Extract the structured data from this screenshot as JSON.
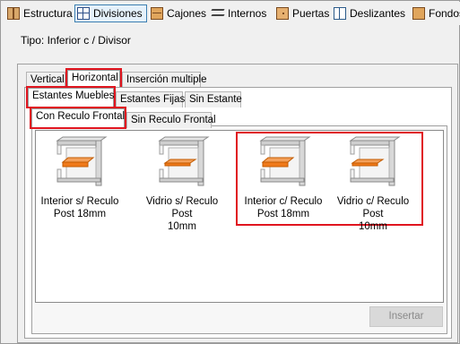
{
  "toolbar": {
    "items": [
      {
        "label": "Estructura",
        "icon": "structure-icon"
      },
      {
        "label": "Divisiones",
        "icon": "divisions-icon",
        "selected": true
      },
      {
        "label": "Cajones",
        "icon": "drawers-icon"
      },
      {
        "label": "Internos",
        "icon": "internals-icon"
      },
      {
        "label": "Puertas",
        "icon": "doors-icon"
      },
      {
        "label": "Deslizantes",
        "icon": "sliding-icon"
      },
      {
        "label": "Fondos",
        "icon": "backs-icon"
      }
    ]
  },
  "tipo": "Tipo: Inferior c / Divisor",
  "tabs_level1": [
    "Vertical",
    "Horizontal",
    "Inserción multiple"
  ],
  "tabs_level2": [
    "Estantes Muebles",
    "Estantes Fijas",
    "Sin Estante"
  ],
  "tabs_level3": [
    "Con Reculo Frontal",
    "Sin Reculo Frontal"
  ],
  "items": [
    {
      "label_line1": "Interior s/ Reculo",
      "label_line2": "Post 18mm",
      "shelf": "orange",
      "highlighted": false
    },
    {
      "label_line1": "Vidrio s/ Reculo Post",
      "label_line2": "10mm",
      "shelf": "orange",
      "highlighted": false
    },
    {
      "label_line1": "Interior c/ Reculo",
      "label_line2": "Post 18mm",
      "shelf": "orange",
      "highlighted": true
    },
    {
      "label_line1": "Vidrio c/ Reculo Post",
      "label_line2": "10mm",
      "shelf": "orange",
      "highlighted": true
    }
  ],
  "insert_button": "Insertar",
  "colors": {
    "highlight": "#e0151f",
    "shelf": "#f07a1a"
  }
}
